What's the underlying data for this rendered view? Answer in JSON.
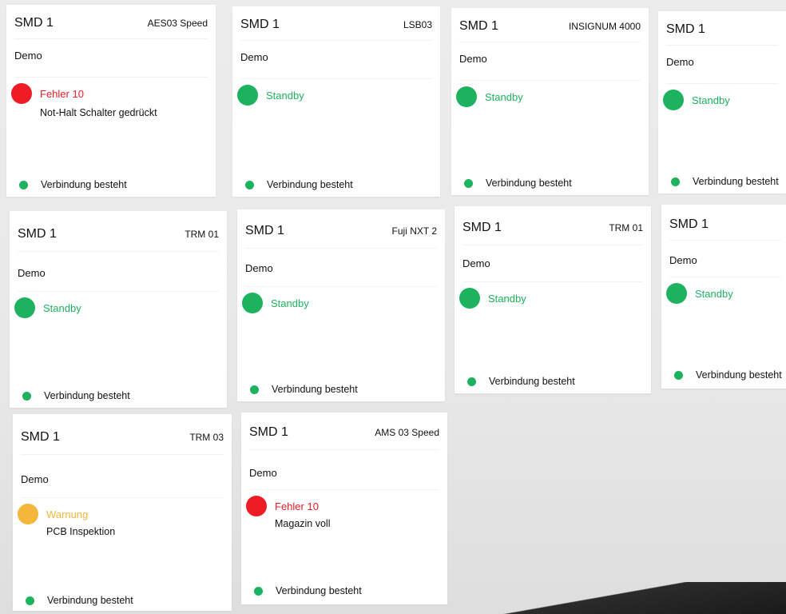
{
  "colors": {
    "error": "#ef1b25",
    "standby": "#1db25d",
    "warning": "#f4b63b",
    "connected": "#1db25d"
  },
  "cards": [
    {
      "title": "SMD 1",
      "model": "AES03 Speed",
      "subtitle": "Demo",
      "state": "error",
      "status": "Fehler 10",
      "detail": "Not-Halt Schalter gedrückt",
      "connection": "Verbindung besteht"
    },
    {
      "title": "SMD 1",
      "model": "LSB03",
      "subtitle": "Demo",
      "state": "standby",
      "status": "Standby",
      "detail": "",
      "connection": "Verbindung besteht"
    },
    {
      "title": "SMD 1",
      "model": "INSIGNUM 4000",
      "subtitle": "Demo",
      "state": "standby",
      "status": "Standby",
      "detail": "",
      "connection": "Verbindung besteht"
    },
    {
      "title": "SMD 1",
      "model": "",
      "subtitle": "Demo",
      "state": "standby",
      "status": "Standby",
      "detail": "",
      "connection": "Verbindung besteht"
    },
    {
      "title": "SMD 1",
      "model": "TRM 01",
      "subtitle": "Demo",
      "state": "standby",
      "status": "Standby",
      "detail": "",
      "connection": "Verbindung besteht"
    },
    {
      "title": "SMD 1",
      "model": "Fuji NXT 2",
      "subtitle": "Demo",
      "state": "standby",
      "status": "Standby",
      "detail": "",
      "connection": "Verbindung besteht"
    },
    {
      "title": "SMD 1",
      "model": "TRM 01",
      "subtitle": "Demo",
      "state": "standby",
      "status": "Standby",
      "detail": "",
      "connection": "Verbindung besteht"
    },
    {
      "title": "SMD 1",
      "model": "",
      "subtitle": "Demo",
      "state": "standby",
      "status": "Standby",
      "detail": "",
      "connection": "Verbindung besteht"
    },
    {
      "title": "SMD 1",
      "model": "TRM 03",
      "subtitle": "Demo",
      "state": "warning",
      "status": "Warnung",
      "detail": "PCB Inspektion",
      "connection": "Verbindung besteht"
    },
    {
      "title": "SMD 1",
      "model": "AMS 03 Speed",
      "subtitle": "Demo",
      "state": "error",
      "status": "Fehler 10",
      "detail": "Magazin voll",
      "connection": "Verbindung besteht"
    }
  ]
}
